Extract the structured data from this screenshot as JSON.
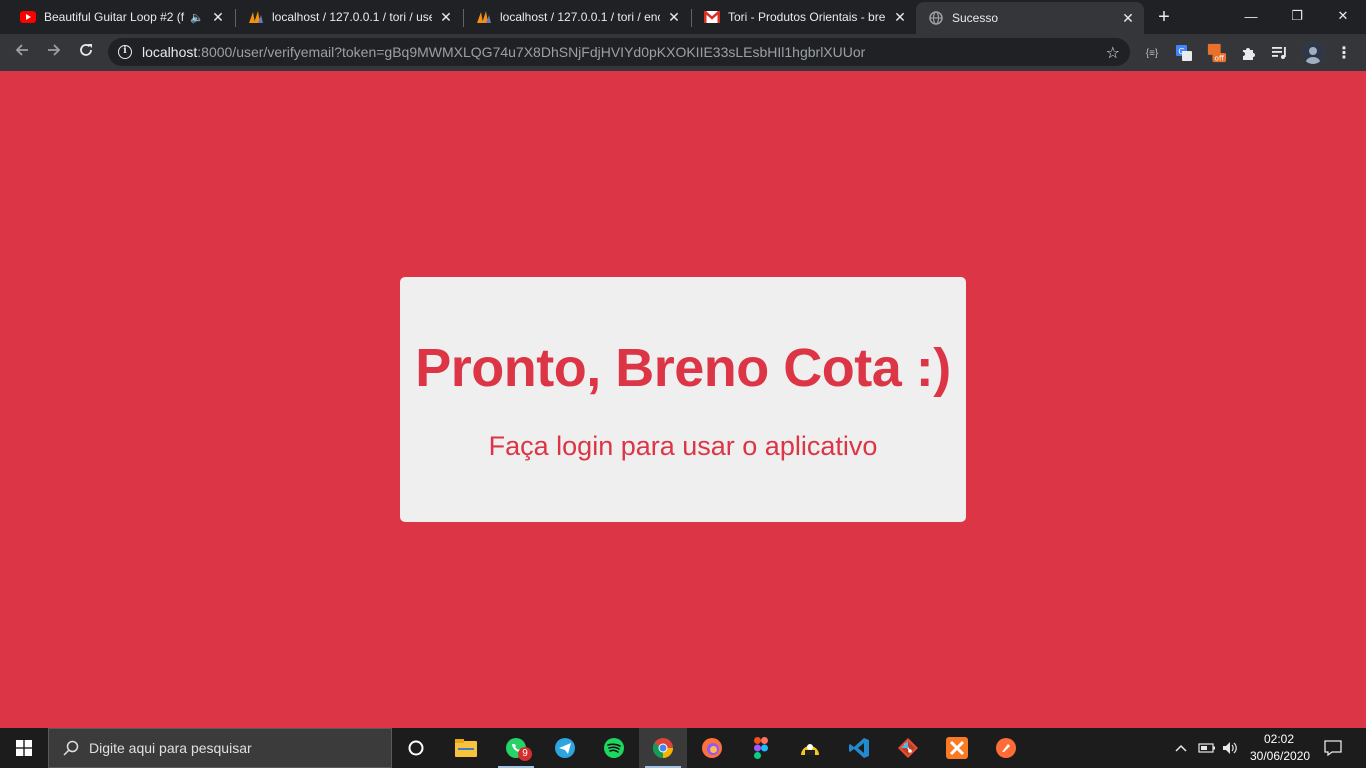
{
  "browser": {
    "tabs": [
      {
        "title": "Beautiful Guitar Loop #2 (f",
        "favicon": "youtube-icon",
        "audio": true
      },
      {
        "title": "localhost / 127.0.0.1 / tori / use",
        "favicon": "phpmyadmin-icon"
      },
      {
        "title": "localhost / 127.0.0.1 / tori / enc",
        "favicon": "phpmyadmin-icon"
      },
      {
        "title": "Tori - Produtos Orientais - bren",
        "favicon": "gmail-icon"
      },
      {
        "title": "Sucesso",
        "favicon": "globe-icon",
        "active": true
      }
    ],
    "close_glyph": "✕",
    "new_tab_glyph": "+",
    "window_controls": {
      "minimize": "—",
      "maximize": "❐",
      "close": "✕"
    },
    "address": {
      "host": "localhost",
      "path": ":8000/user/verifyemail?token=gBq9MWMXLQG74u7X8DhSNjFdjHVIYd0pKXOKIIE33sLEsbHIl1hgbrlXUUor"
    },
    "extensions": [
      "code-ext-icon",
      "translate-ext-icon",
      "off-ext-icon",
      "puzzle-icon",
      "media-queue-icon",
      "profile-avatar"
    ],
    "ext_off_label": "off"
  },
  "page": {
    "heading": "Pronto, Breno Cota :)",
    "subtext": "Faça login para usar o aplicativo",
    "accent": "#dc3545",
    "card_bg": "#efefef"
  },
  "taskbar": {
    "search_placeholder": "Digite aqui para pesquisar",
    "apps": [
      "cortana-icon",
      "file-explorer-icon",
      "whatsapp-icon",
      "telegram-icon",
      "spotify-icon",
      "chrome-icon",
      "firefox-icon",
      "figma-icon",
      "thunderbird-icon",
      "vscode-icon",
      "git-icon",
      "xampp-icon",
      "postman-icon"
    ],
    "whatsapp_badge": "9",
    "clock": {
      "time": "02:02",
      "date": "30/06/2020"
    }
  }
}
